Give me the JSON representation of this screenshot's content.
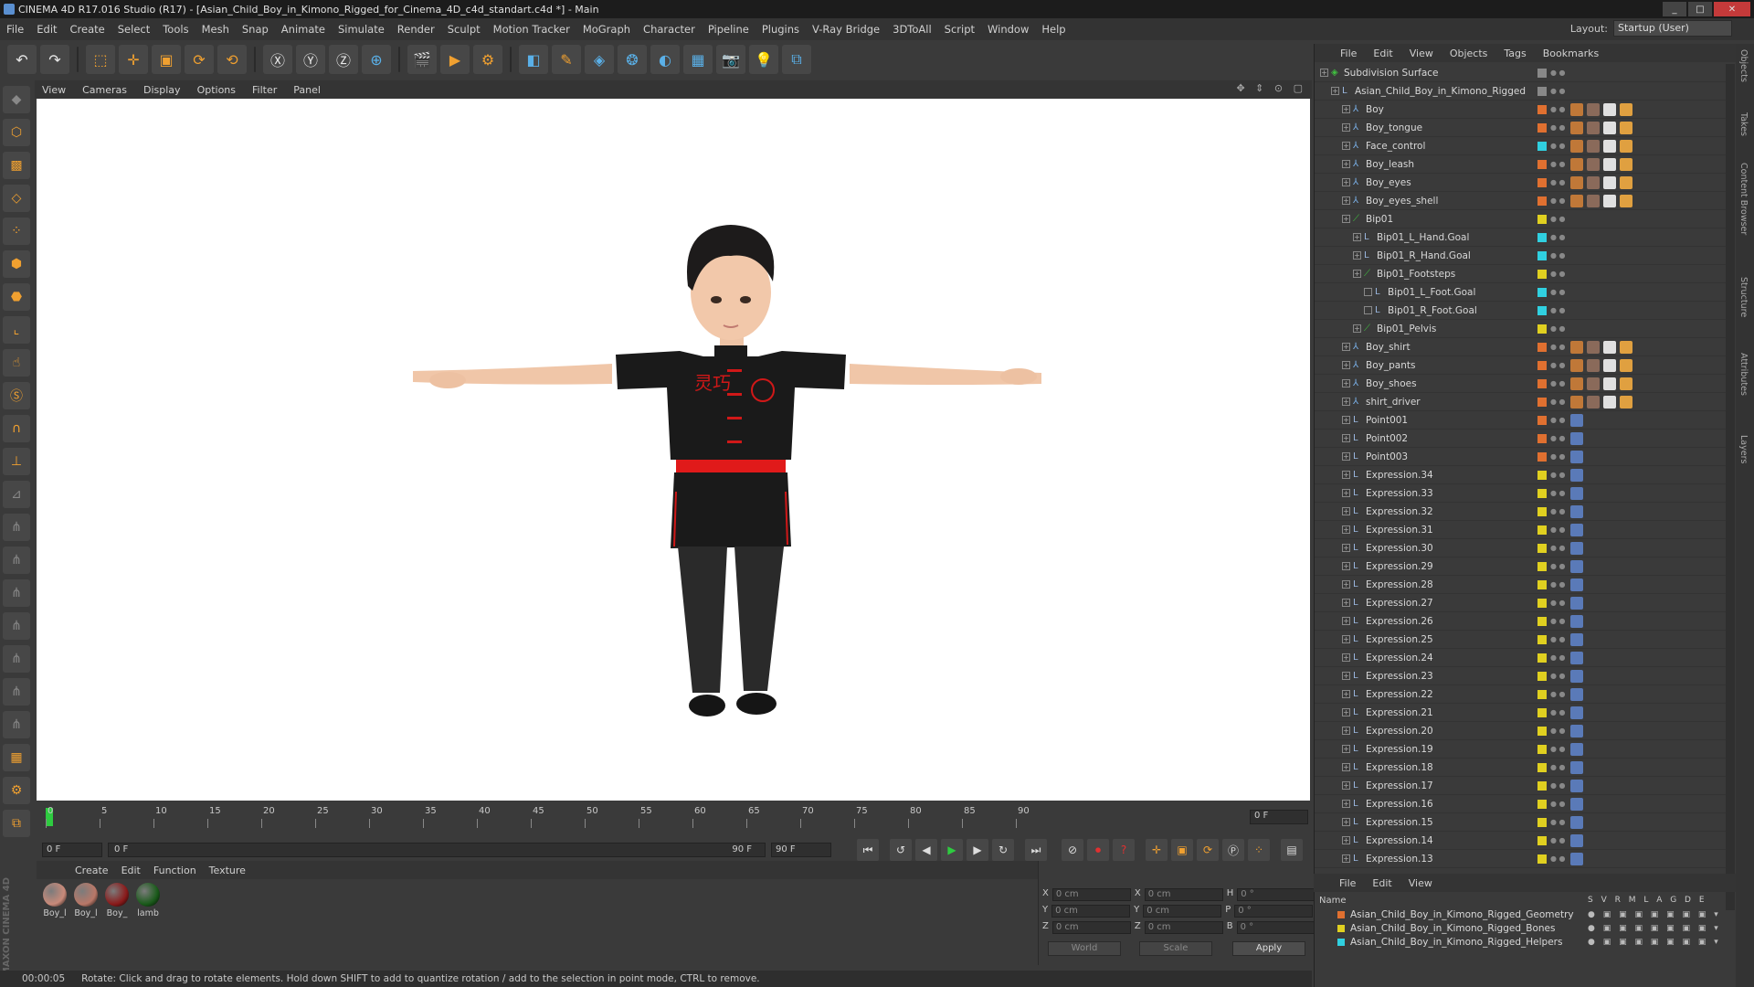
{
  "window": {
    "title": "CINEMA 4D R17.016 Studio (R17) - [Asian_Child_Boy_in_Kimono_Rigged_for_Cinema_4D_c4d_standart.c4d *] - Main"
  },
  "menubar": [
    "File",
    "Edit",
    "Create",
    "Select",
    "Tools",
    "Mesh",
    "Snap",
    "Animate",
    "Simulate",
    "Render",
    "Sculpt",
    "Motion Tracker",
    "MoGraph",
    "Character",
    "Pipeline",
    "Plugins",
    "V-Ray Bridge",
    "3DToAll",
    "Script",
    "Window",
    "Help"
  ],
  "layout": {
    "label": "Layout:",
    "value": "Startup (User)"
  },
  "viewport": {
    "menu": [
      "View",
      "Cameras",
      "Display",
      "Options",
      "Filter",
      "Panel"
    ],
    "shirt_text": "灵巧"
  },
  "timeline": {
    "ticks": [
      "0",
      "5",
      "10",
      "15",
      "20",
      "25",
      "30",
      "35",
      "40",
      "45",
      "50",
      "55",
      "60",
      "65",
      "70",
      "75",
      "80",
      "85",
      "90"
    ],
    "frame": "0 F"
  },
  "transport": {
    "start": "0 F",
    "range_start": "0 F",
    "range_end": "90 F",
    "end": "90 F"
  },
  "materials": {
    "menu": [
      "Create",
      "Edit",
      "Function",
      "Texture"
    ],
    "items": [
      {
        "label": "Boy_l",
        "color": "#c98a7a"
      },
      {
        "label": "Boy_l",
        "color": "#b97868"
      },
      {
        "label": "Boy_",
        "color": "#8a1a1a"
      },
      {
        "label": "lamb",
        "color": "#1a5a1a"
      }
    ]
  },
  "coords": {
    "x": "0 cm",
    "y": "0 cm",
    "z": "0 cm",
    "x2": "0 cm",
    "y2": "0 cm",
    "z2": "0 cm",
    "h": "0 °",
    "p": "0 °",
    "b": "0 °",
    "world": "World",
    "scale": "Scale",
    "apply": "Apply"
  },
  "status": {
    "time": "00:00:05",
    "text": "Rotate: Click and drag to rotate elements. Hold down SHIFT to add to quantize rotation / add to the selection in point mode, CTRL to remove."
  },
  "object_manager": {
    "menu": [
      "File",
      "Edit",
      "View",
      "Objects",
      "Tags",
      "Bookmarks"
    ],
    "rows": [
      {
        "name": "Subdivision Surface",
        "indent": 0,
        "color": "#888888",
        "icon": "subdivision-icon"
      },
      {
        "name": "Asian_Child_Boy_in_Kimono_Rigged",
        "indent": 1,
        "color": "#888888",
        "icon": "null-icon"
      },
      {
        "name": "Boy",
        "indent": 2,
        "color": "#e07030",
        "icon": "bone-icon"
      },
      {
        "name": "Boy_tongue",
        "indent": 2,
        "color": "#e07030",
        "icon": "bone-icon"
      },
      {
        "name": "Face_control",
        "indent": 2,
        "color": "#30d0e0",
        "icon": "bone-icon"
      },
      {
        "name": "Boy_leash",
        "indent": 2,
        "color": "#e07030",
        "icon": "bone-icon"
      },
      {
        "name": "Boy_eyes",
        "indent": 2,
        "color": "#e07030",
        "icon": "bone-icon"
      },
      {
        "name": "Boy_eyes_shell",
        "indent": 2,
        "color": "#e07030",
        "icon": "bone-icon"
      },
      {
        "name": "Bip01",
        "indent": 2,
        "color": "#e0d020",
        "icon": "joint-icon"
      },
      {
        "name": "Bip01_L_Hand.Goal",
        "indent": 3,
        "color": "#30d0e0",
        "icon": "null-icon"
      },
      {
        "name": "Bip01_R_Hand.Goal",
        "indent": 3,
        "color": "#30d0e0",
        "icon": "null-icon"
      },
      {
        "name": "Bip01_Footsteps",
        "indent": 3,
        "color": "#e0d020",
        "icon": "joint-icon"
      },
      {
        "name": "Bip01_L_Foot.Goal",
        "indent": 4,
        "color": "#30d0e0",
        "icon": "null-icon"
      },
      {
        "name": "Bip01_R_Foot.Goal",
        "indent": 4,
        "color": "#30d0e0",
        "icon": "null-icon"
      },
      {
        "name": "Bip01_Pelvis",
        "indent": 3,
        "color": "#e0d020",
        "icon": "joint-icon"
      },
      {
        "name": "Boy_shirt",
        "indent": 2,
        "color": "#e07030",
        "icon": "bone-icon"
      },
      {
        "name": "Boy_pants",
        "indent": 2,
        "color": "#e07030",
        "icon": "bone-icon"
      },
      {
        "name": "Boy_shoes",
        "indent": 2,
        "color": "#e07030",
        "icon": "bone-icon"
      },
      {
        "name": "shirt_driver",
        "indent": 2,
        "color": "#e07030",
        "icon": "bone-icon"
      },
      {
        "name": "Point001",
        "indent": 2,
        "color": "#e07030",
        "icon": "null-icon"
      },
      {
        "name": "Point002",
        "indent": 2,
        "color": "#e07030",
        "icon": "null-icon"
      },
      {
        "name": "Point003",
        "indent": 2,
        "color": "#e07030",
        "icon": "null-icon"
      },
      {
        "name": "Expression.34",
        "indent": 2,
        "color": "#e0d020",
        "icon": "null-icon"
      },
      {
        "name": "Expression.33",
        "indent": 2,
        "color": "#e0d020",
        "icon": "null-icon"
      },
      {
        "name": "Expression.32",
        "indent": 2,
        "color": "#e0d020",
        "icon": "null-icon"
      },
      {
        "name": "Expression.31",
        "indent": 2,
        "color": "#e0d020",
        "icon": "null-icon"
      },
      {
        "name": "Expression.30",
        "indent": 2,
        "color": "#e0d020",
        "icon": "null-icon"
      },
      {
        "name": "Expression.29",
        "indent": 2,
        "color": "#e0d020",
        "icon": "null-icon"
      },
      {
        "name": "Expression.28",
        "indent": 2,
        "color": "#e0d020",
        "icon": "null-icon"
      },
      {
        "name": "Expression.27",
        "indent": 2,
        "color": "#e0d020",
        "icon": "null-icon"
      },
      {
        "name": "Expression.26",
        "indent": 2,
        "color": "#e0d020",
        "icon": "null-icon"
      },
      {
        "name": "Expression.25",
        "indent": 2,
        "color": "#e0d020",
        "icon": "null-icon"
      },
      {
        "name": "Expression.24",
        "indent": 2,
        "color": "#e0d020",
        "icon": "null-icon"
      },
      {
        "name": "Expression.23",
        "indent": 2,
        "color": "#e0d020",
        "icon": "null-icon"
      },
      {
        "name": "Expression.22",
        "indent": 2,
        "color": "#e0d020",
        "icon": "null-icon"
      },
      {
        "name": "Expression.21",
        "indent": 2,
        "color": "#e0d020",
        "icon": "null-icon"
      },
      {
        "name": "Expression.20",
        "indent": 2,
        "color": "#e0d020",
        "icon": "null-icon"
      },
      {
        "name": "Expression.19",
        "indent": 2,
        "color": "#e0d020",
        "icon": "null-icon"
      },
      {
        "name": "Expression.18",
        "indent": 2,
        "color": "#e0d020",
        "icon": "null-icon"
      },
      {
        "name": "Expression.17",
        "indent": 2,
        "color": "#e0d020",
        "icon": "null-icon"
      },
      {
        "name": "Expression.16",
        "indent": 2,
        "color": "#e0d020",
        "icon": "null-icon"
      },
      {
        "name": "Expression.15",
        "indent": 2,
        "color": "#e0d020",
        "icon": "null-icon"
      },
      {
        "name": "Expression.14",
        "indent": 2,
        "color": "#e0d020",
        "icon": "null-icon"
      },
      {
        "name": "Expression.13",
        "indent": 2,
        "color": "#e0d020",
        "icon": "null-icon"
      }
    ]
  },
  "layers": {
    "menu": [
      "File",
      "Edit",
      "View"
    ],
    "header_name": "Name",
    "header_flags": "S V R M L A G D E",
    "rows": [
      {
        "name": "Asian_Child_Boy_in_Kimono_Rigged_Geometry",
        "color": "#e07030"
      },
      {
        "name": "Asian_Child_Boy_in_Kimono_Rigged_Bones",
        "color": "#e0d020"
      },
      {
        "name": "Asian_Child_Boy_in_Kimono_Rigged_Helpers",
        "color": "#30d0e0"
      }
    ]
  },
  "side_tabs": [
    "Objects",
    "Takes",
    "Content Browser",
    "Structure",
    "Attributes",
    "Layers"
  ]
}
